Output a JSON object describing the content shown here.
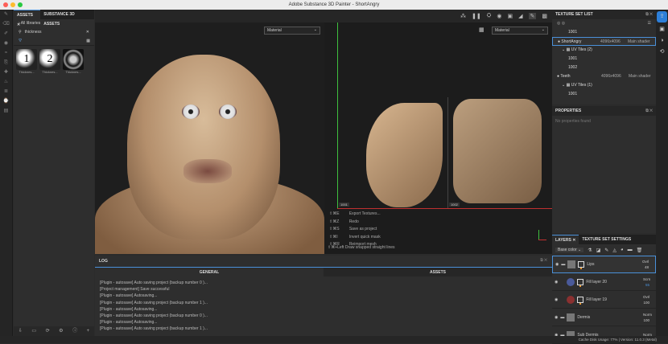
{
  "window": {
    "title": "Adobe Substance 3D Painter - ShortAngry"
  },
  "assets": {
    "tabs": [
      "ASSETS",
      "SUBSTANCE 3D ASSETS"
    ],
    "library": "All libraries",
    "search_value": "thickness",
    "items": [
      {
        "glyph": "1",
        "label": "Thicknes..."
      },
      {
        "glyph": "2",
        "label": "Thicknes..."
      },
      {
        "glyph": "",
        "label": "Thicknes..."
      }
    ]
  },
  "viewport3d": {
    "mode": "Material"
  },
  "viewport2d": {
    "mode": "Material",
    "tile_labels": [
      "1001",
      "1002"
    ],
    "shortcuts": [
      {
        "keys": "⇧⌘E",
        "action": "Export Textures..."
      },
      {
        "keys": "⇧⌘Z",
        "action": "Redo"
      },
      {
        "keys": "⇧⌘S",
        "action": "Save as project"
      },
      {
        "keys": "⇧⌘I",
        "action": "Invert quick mask"
      },
      {
        "keys": "⇧⌘R",
        "action": "Reimport mesh"
      }
    ],
    "hint": "⇧⌘+Left  Draw snapped straight lines"
  },
  "log": {
    "title": "LOG",
    "tabs": [
      "GENERAL",
      "ASSETS"
    ],
    "lines": [
      "[Plugin - autosave] Auto saving project (backup number 0 )...",
      "[Project management] Save successful",
      "[Plugin - autosave] Autosaving...",
      "[Plugin - autosave] Auto saving project (backup number 1 )...",
      "[Plugin - autosave] Autosaving...",
      "[Plugin - autosave] Auto saving project (backup number 0 )...",
      "[Plugin - autosave] Autosaving...",
      "[Plugin - autosave] Auto saving project (backup number 1 )..."
    ]
  },
  "texture_set_list": {
    "title": "TEXTURE SET LIST",
    "rows": [
      {
        "name": "1001",
        "indent": 2,
        "res": "",
        "shader": ""
      },
      {
        "name": "ShortAngry",
        "indent": 0,
        "res": "4096x4096",
        "shader": "Main shader",
        "selected": true
      },
      {
        "name": "UV Tiles (2)",
        "indent": 1,
        "res": "",
        "shader": ""
      },
      {
        "name": "1001",
        "indent": 2,
        "res": "",
        "shader": ""
      },
      {
        "name": "1002",
        "indent": 2,
        "res": "",
        "shader": ""
      },
      {
        "name": "Teeth",
        "indent": 0,
        "res": "4096x4096",
        "shader": "Main shader"
      },
      {
        "name": "UV Tiles (1)",
        "indent": 1,
        "res": "",
        "shader": ""
      },
      {
        "name": "1001",
        "indent": 2,
        "res": "",
        "shader": ""
      }
    ]
  },
  "properties": {
    "title": "PROPERTIES",
    "empty": "No properties found"
  },
  "layers": {
    "tabs": [
      "LAYERS",
      "TEXTURE SET SETTINGS"
    ],
    "channel": "Base color",
    "items": [
      {
        "name": "Lips",
        "blend": "Ovrl",
        "opacity": "48",
        "type": "folder",
        "color": "#777777"
      },
      {
        "name": "Fill layer 20",
        "blend": "Scrn",
        "opacity": "55",
        "type": "fill",
        "color": "#4a5a9a"
      },
      {
        "name": "Fill layer 19",
        "blend": "Ovrl",
        "opacity": "100",
        "type": "fill",
        "color": "#8a3030"
      },
      {
        "name": "Dermis",
        "blend": "Norm",
        "opacity": "100",
        "type": "folder",
        "color": "#777777"
      },
      {
        "name": "Sub Dermis",
        "blend": "Norm",
        "opacity": "",
        "type": "folder",
        "color": "#777777"
      }
    ]
  },
  "status": {
    "text": "Cache Disk Usage:   77% | Version: 11.0.3 (Metal)"
  },
  "colors": {
    "accent": "#4a90d9",
    "mask_bar": "#e8962e",
    "uv_green": "#3fbf3f",
    "uv_red": "#c03030"
  }
}
